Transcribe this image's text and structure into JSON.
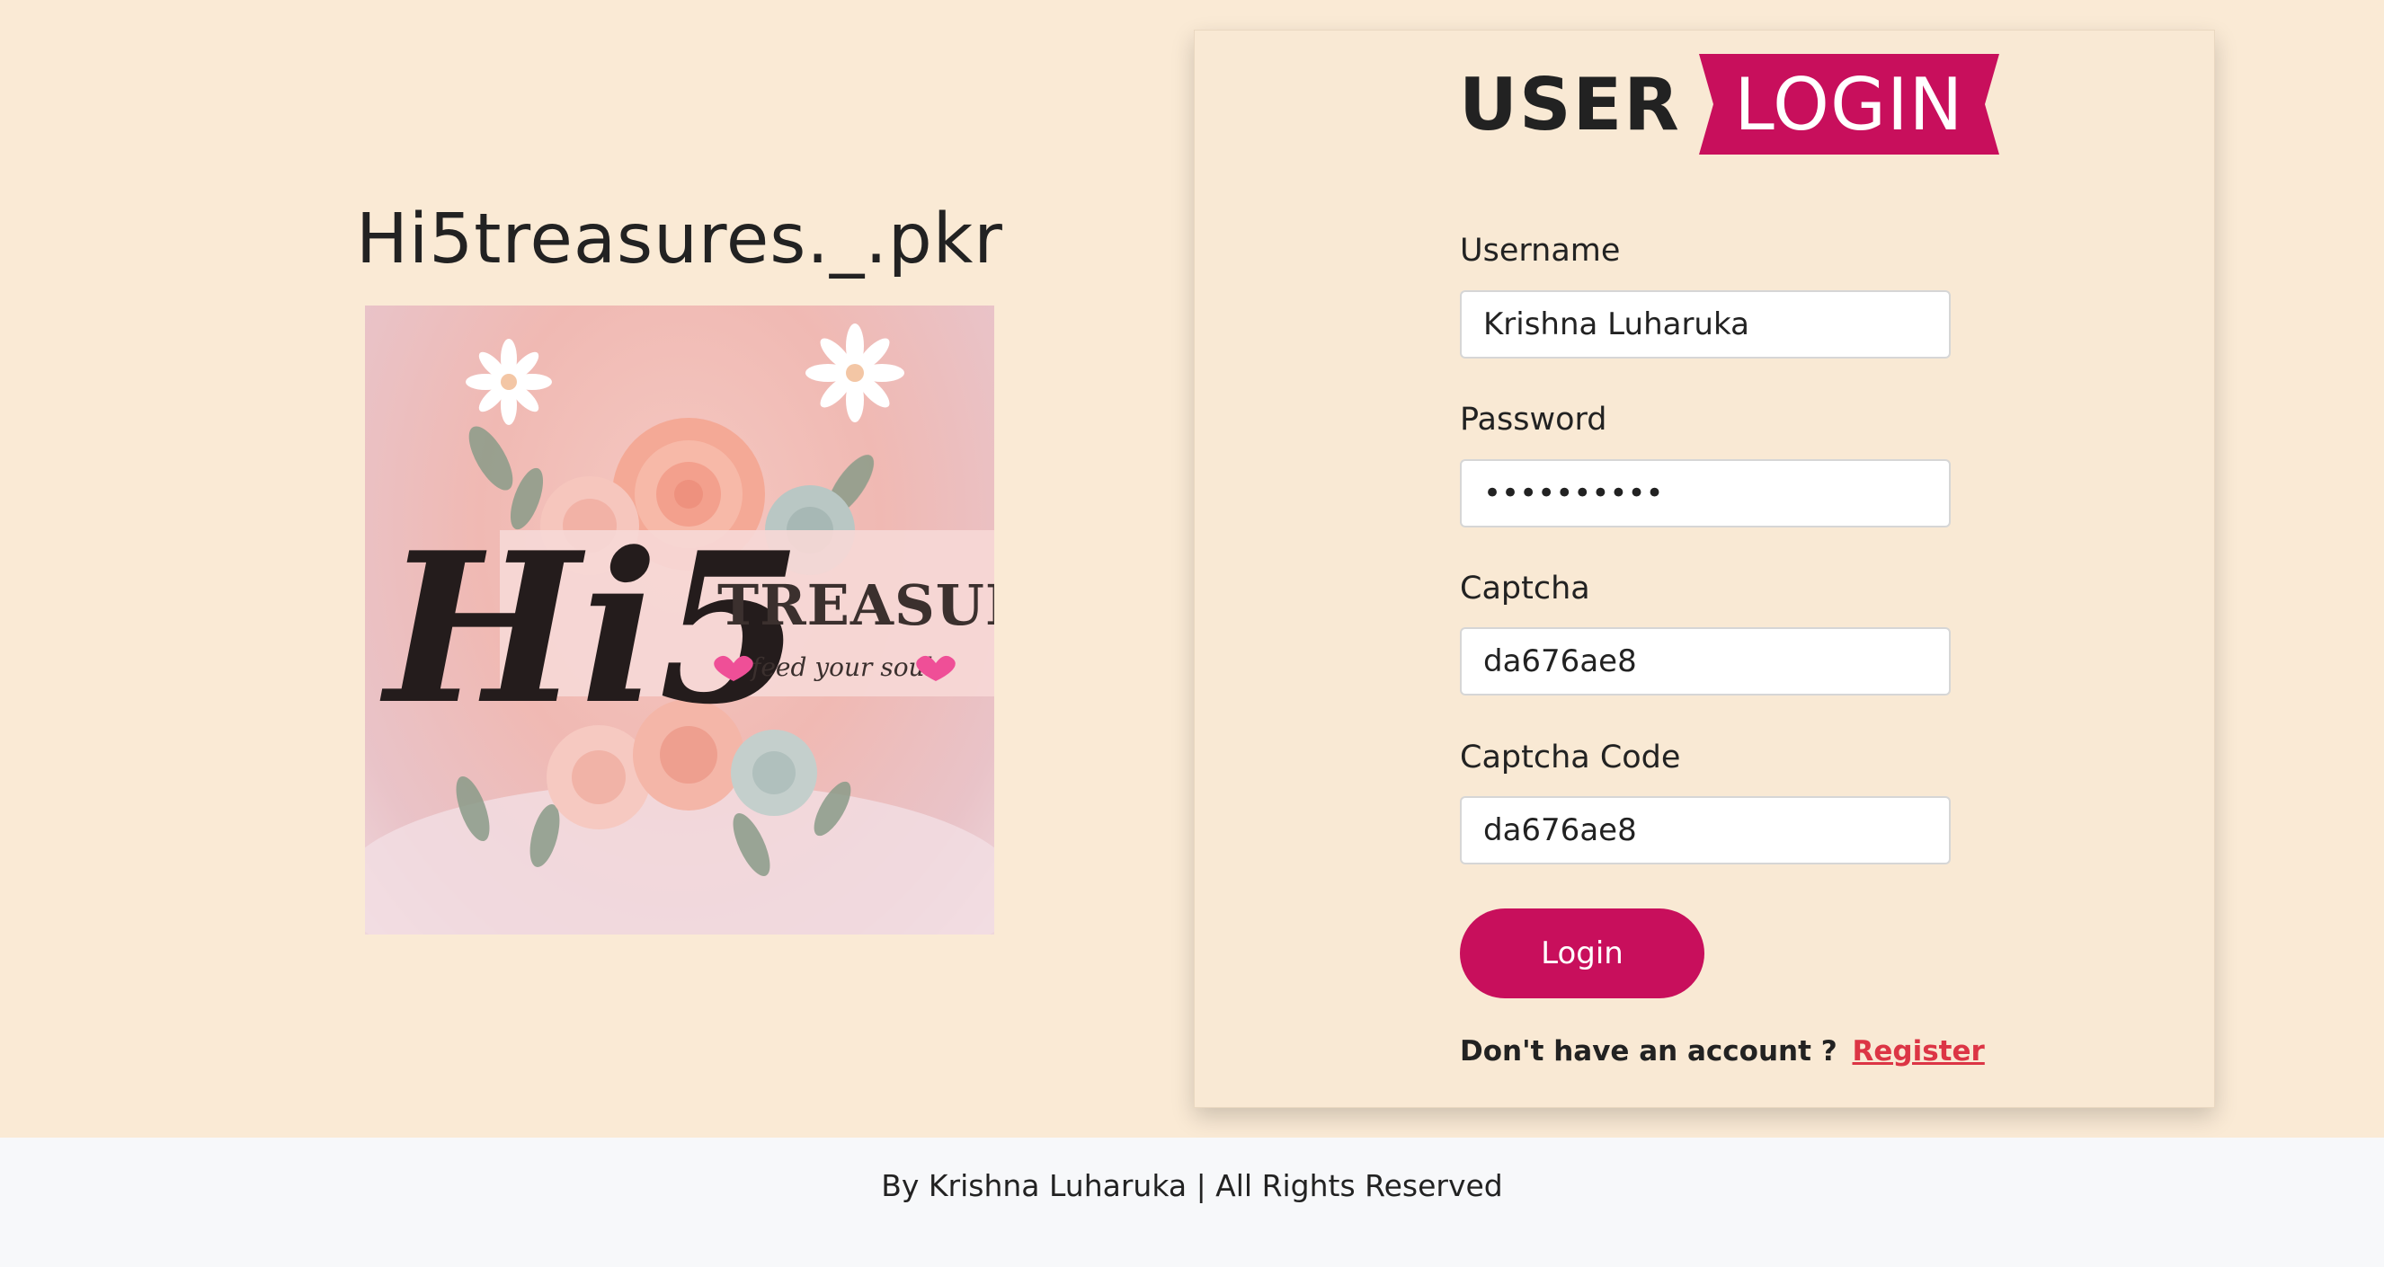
{
  "brand": {
    "title": "Hi5treasures._.pkr",
    "logo": {
      "word_main": "Hi5",
      "word_sub": "TREASURES",
      "tagline": "feed your soul"
    }
  },
  "login_form": {
    "heading_user": "USER",
    "heading_login": "LOGIN",
    "username_label": "Username",
    "username_value": "Krishna Luharuka",
    "password_label": "Password",
    "password_value": "••••••••••",
    "captcha_label": "Captcha",
    "captcha_value": "da676ae8",
    "captcha_code_label": "Captcha Code",
    "captcha_code_value": "da676ae8",
    "login_button": "Login",
    "no_account_text": "Don't have an account ?",
    "register_link": "Register"
  },
  "footer": {
    "text": "By Krishna Luharuka | All Rights Reserved"
  },
  "colors": {
    "accent": "#c80f5c",
    "background": "#faead5",
    "footer_bg": "#f7f8fa",
    "link": "#dc3545"
  }
}
